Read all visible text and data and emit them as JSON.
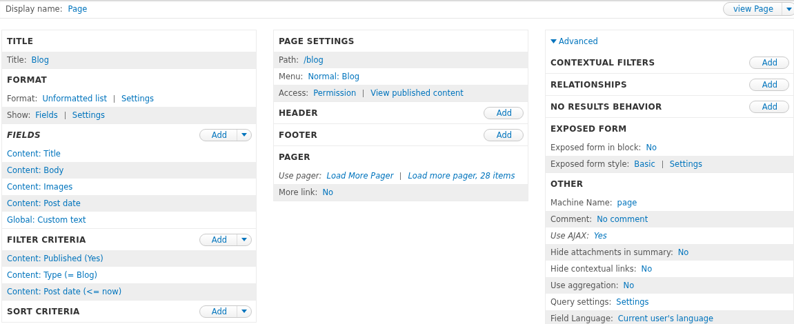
{
  "display_bar": {
    "label": "Display name:",
    "value": "Page",
    "view_button": {
      "label": "view Page",
      "dropdown": true
    }
  },
  "columns": [
    {
      "sections": [
        {
          "title": "TITLE",
          "italic": false,
          "rows": [
            {
              "label": "Title:",
              "italic": false,
              "shaded": true,
              "links": [
                "Blog"
              ]
            }
          ]
        },
        {
          "title": "FORMAT",
          "italic": false,
          "rows": [
            {
              "label": "Format:",
              "italic": false,
              "shaded": false,
              "links": [
                "Unformatted list",
                "Settings"
              ]
            },
            {
              "label": "Show:",
              "italic": false,
              "shaded": true,
              "links": [
                "Fields",
                "Settings"
              ]
            }
          ]
        },
        {
          "title": "FIELDS",
          "italic": true,
          "add": {
            "label": "Add",
            "dropdown": true
          },
          "rows": [
            {
              "italic": false,
              "shaded": false,
              "links": [
                "Content: Title"
              ]
            },
            {
              "italic": false,
              "shaded": true,
              "links": [
                "Content: Body"
              ]
            },
            {
              "italic": false,
              "shaded": false,
              "links": [
                "Content: Images"
              ]
            },
            {
              "italic": false,
              "shaded": true,
              "links": [
                "Content: Post date"
              ]
            },
            {
              "italic": false,
              "shaded": false,
              "links": [
                "Global: Custom text"
              ]
            }
          ]
        },
        {
          "title": "FILTER CRITERIA",
          "italic": false,
          "add": {
            "label": "Add",
            "dropdown": true
          },
          "rows": [
            {
              "italic": false,
              "shaded": true,
              "links": [
                "Content: Published (Yes)"
              ]
            },
            {
              "italic": false,
              "shaded": false,
              "links": [
                "Content: Type (= Blog)"
              ]
            },
            {
              "italic": false,
              "shaded": true,
              "links": [
                "Content: Post date (<= now)"
              ]
            }
          ]
        },
        {
          "title": "SORT CRITERIA",
          "italic": false,
          "add": {
            "label": "Add",
            "dropdown": true
          }
        }
      ]
    },
    {
      "sections": [
        {
          "title": "PAGE SETTINGS",
          "italic": false,
          "rows": [
            {
              "label": "Path:",
              "italic": false,
              "shaded": true,
              "links": [
                "/blog"
              ]
            },
            {
              "label": "Menu:",
              "italic": false,
              "shaded": false,
              "links": [
                "Normal: Blog"
              ]
            },
            {
              "label": "Access:",
              "italic": false,
              "shaded": true,
              "links": [
                "Permission",
                "View published content"
              ]
            }
          ]
        },
        {
          "title": "HEADER",
          "italic": false,
          "add": {
            "label": "Add",
            "dropdown": false
          }
        },
        {
          "title": "FOOTER",
          "italic": false,
          "add": {
            "label": "Add",
            "dropdown": false
          }
        },
        {
          "title": "PAGER",
          "italic": false,
          "rows": [
            {
              "label": "Use pager:",
              "italic": true,
              "shaded": false,
              "links": [
                "Load More Pager",
                "Load more pager, 28 items"
              ]
            },
            {
              "label": "More link:",
              "italic": false,
              "shaded": true,
              "links": [
                "No"
              ]
            }
          ]
        }
      ]
    },
    {
      "advanced": {
        "label": "Advanced",
        "expanded": true
      },
      "sections": [
        {
          "title": "CONTEXTUAL FILTERS",
          "italic": false,
          "add": {
            "label": "Add",
            "dropdown": false
          }
        },
        {
          "title": "RELATIONSHIPS",
          "italic": false,
          "add": {
            "label": "Add",
            "dropdown": false
          }
        },
        {
          "title": "NO RESULTS BEHAVIOR",
          "italic": false,
          "add": {
            "label": "Add",
            "dropdown": false
          }
        },
        {
          "title": "EXPOSED FORM",
          "italic": false,
          "rows": [
            {
              "label": "Exposed form in block:",
              "italic": false,
              "shaded": false,
              "links": [
                "No"
              ]
            },
            {
              "label": "Exposed form style:",
              "italic": false,
              "shaded": true,
              "links": [
                "Basic",
                "Settings"
              ]
            }
          ]
        },
        {
          "title": "OTHER",
          "italic": false,
          "rows": [
            {
              "label": "Machine Name:",
              "italic": false,
              "shaded": false,
              "links": [
                "page"
              ]
            },
            {
              "label": "Comment:",
              "italic": false,
              "shaded": true,
              "links": [
                "No comment"
              ]
            },
            {
              "label": "Use AJAX:",
              "italic": true,
              "shaded": false,
              "links": [
                "Yes"
              ]
            },
            {
              "label": "Hide attachments in summary:",
              "italic": false,
              "shaded": true,
              "links": [
                "No"
              ]
            },
            {
              "label": "Hide contextual links:",
              "italic": false,
              "shaded": false,
              "links": [
                "No"
              ]
            },
            {
              "label": "Use aggregation:",
              "italic": false,
              "shaded": true,
              "links": [
                "No"
              ]
            },
            {
              "label": "Query settings:",
              "italic": false,
              "shaded": false,
              "links": [
                "Settings"
              ]
            },
            {
              "label": "Field Language:",
              "italic": false,
              "shaded": true,
              "links": [
                "Current user's language"
              ]
            }
          ]
        }
      ]
    }
  ]
}
